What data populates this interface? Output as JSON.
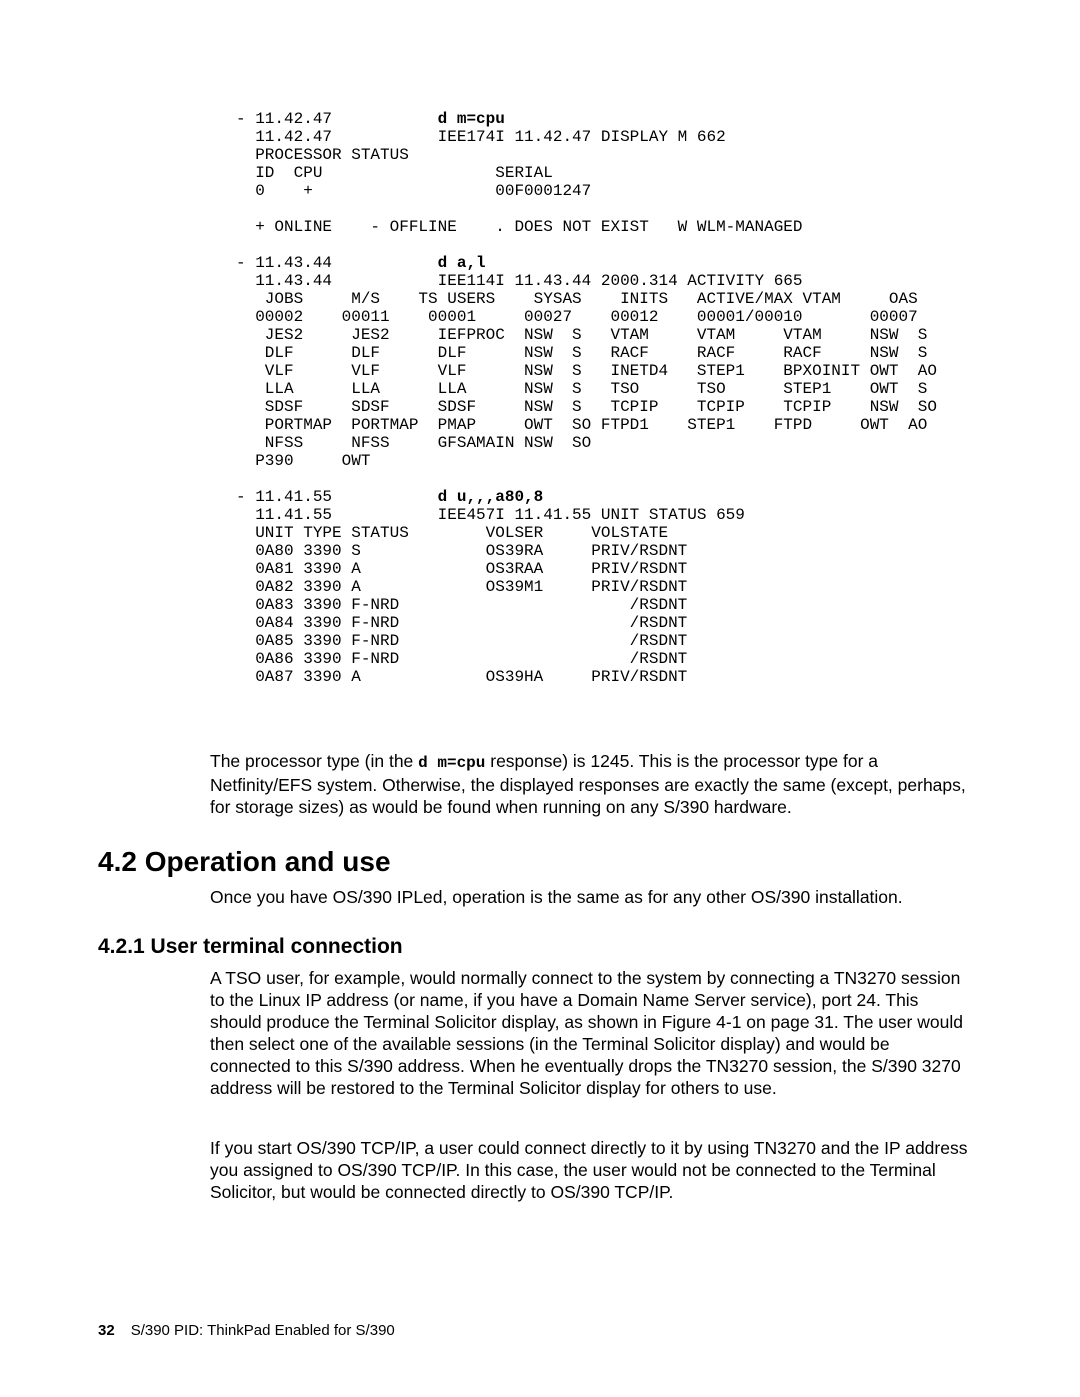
{
  "terminal": {
    "block1": [
      "- 11.42.47           ",
      "  11.42.47           IEE174I 11.42.47 DISPLAY M 662",
      "  PROCESSOR STATUS",
      "  ID  CPU                  SERIAL",
      "  0    +                   00F0001247",
      "",
      "  + ONLINE    - OFFLINE    . DOES NOT EXIST   W WLM-MANAGED"
    ],
    "cmd1": "d m=cpu",
    "block2": [
      "",
      "- 11.43.44           ",
      "  11.43.44           IEE114I 11.43.44 2000.314 ACTIVITY 665",
      "   JOBS     M/S    TS USERS    SYSAS    INITS   ACTIVE/MAX VTAM     OAS",
      "  00002    00011    00001     00027    00012    00001/00010       00007",
      "   JES2     JES2     IEFPROC  NSW  S   VTAM     VTAM     VTAM     NSW  S",
      "   DLF      DLF      DLF      NSW  S   RACF     RACF     RACF     NSW  S",
      "   VLF      VLF      VLF      NSW  S   INETD4   STEP1    BPXOINIT OWT  AO",
      "   LLA      LLA      LLA      NSW  S   TSO      TSO      STEP1    OWT  S",
      "   SDSF     SDSF     SDSF     NSW  S   TCPIP    TCPIP    TCPIP    NSW  SO",
      "   PORTMAP  PORTMAP  PMAP     OWT  SO FTPD1    STEP1    FTPD     OWT  AO",
      "   NFSS     NFSS     GFSAMAIN NSW  SO",
      "  P390     OWT"
    ],
    "cmd2": "d a,l",
    "block3": [
      "",
      "- 11.41.55           ",
      "  11.41.55           IEE457I 11.41.55 UNIT STATUS 659",
      "  UNIT TYPE STATUS        VOLSER     VOLSTATE",
      "  0A80 3390 S             OS39RA     PRIV/RSDNT",
      "  0A81 3390 A             OS3RAA     PRIV/RSDNT",
      "  0A82 3390 A             OS39M1     PRIV/RSDNT",
      "  0A83 3390 F-NRD                        /RSDNT",
      "  0A84 3390 F-NRD                        /RSDNT",
      "  0A85 3390 F-NRD                        /RSDNT",
      "  0A86 3390 F-NRD                        /RSDNT",
      "  0A87 3390 A             OS39HA     PRIV/RSDNT"
    ],
    "cmd3": "d u,,,a80,8"
  },
  "para1a": "The processor type (in the ",
  "para1cmd": "d m=cpu",
  "para1b": " response) is 1245.  This is the processor type for a Netfinity/EFS system.  Otherwise, the displayed responses are exactly the same (except, perhaps, for storage sizes) as would be found when running on any S/390 hardware.",
  "section": "4.2  Operation and use",
  "para2": "Once you have OS/390 IPLed, operation is the same as for any other OS/390 installation.",
  "subsection": "4.2.1  User terminal connection",
  "para3": "A TSO user, for example, would normally connect to the system by connecting a TN3270 session to the Linux IP address (or name, if you have a Domain Name Server service), port 24.  This should produce the Terminal Solicitor display, as shown in Figure 4-1 on page 31.  The user would then select one of the available sessions (in the Terminal Solicitor display) and would be connected to this S/390 address.  When he eventually drops the TN3270 session, the S/390 3270 address will be restored to the Terminal Solicitor display for others to use.",
  "para4": "If you start OS/390 TCP/IP, a user could connect directly to it by using TN3270 and the IP address you assigned to OS/390 TCP/IP.  In this case, the user would not be connected to the Terminal Solicitor, but would be connected directly to OS/390 TCP/IP.",
  "footer_page": "32",
  "footer_title": "S/390 PID: ThinkPad Enabled for S/390"
}
